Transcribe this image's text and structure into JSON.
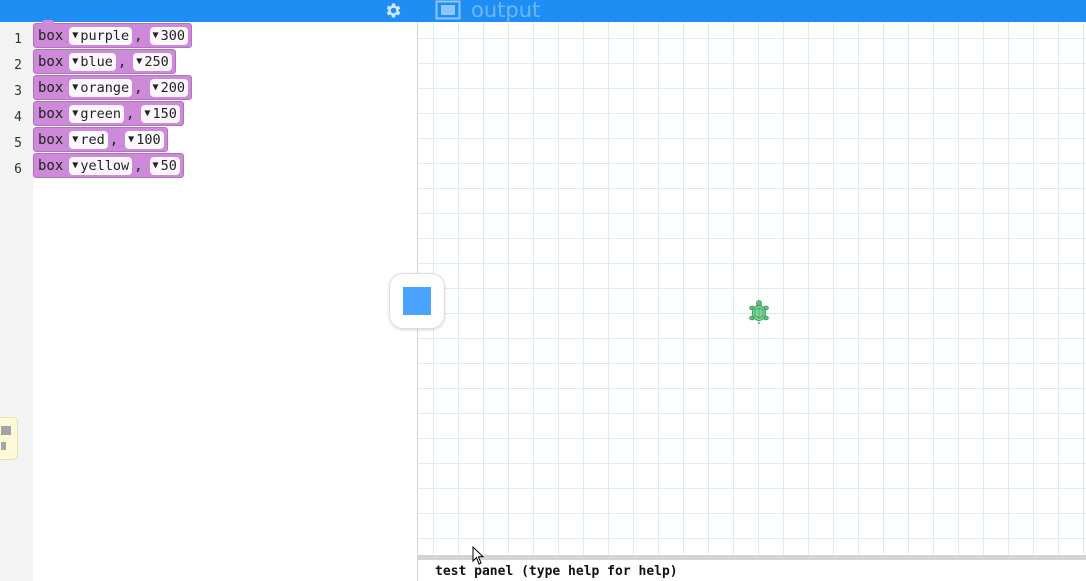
{
  "topbar": {
    "gear_icon": "gear-icon",
    "output_icon": "output-panel-icon",
    "output_label": "output",
    "accent_color": "#1e8ef5"
  },
  "editor": {
    "line_numbers": [
      "1",
      "2",
      "3",
      "4",
      "5",
      "6"
    ],
    "blocks": [
      {
        "keyword": "box",
        "color": "purple",
        "size": "300"
      },
      {
        "keyword": "box",
        "color": "blue",
        "size": "250"
      },
      {
        "keyword": "box",
        "color": "orange",
        "size": "200"
      },
      {
        "keyword": "box",
        "color": "green",
        "size": "150"
      },
      {
        "keyword": "box",
        "color": "red",
        "size": "100"
      },
      {
        "keyword": "box",
        "color": "yellow",
        "size": "50"
      }
    ],
    "comma": ",",
    "dropdown_glyph": "▼",
    "block_color": "#cc8ad8"
  },
  "toggle": {
    "icon": "blocks-text-toggle-icon",
    "color": "#4aa3ff"
  },
  "output": {
    "turtle_icon": "turtle-icon",
    "grid_color": "#ddeee9"
  },
  "test_panel": {
    "label": "test panel (type help for help)"
  }
}
